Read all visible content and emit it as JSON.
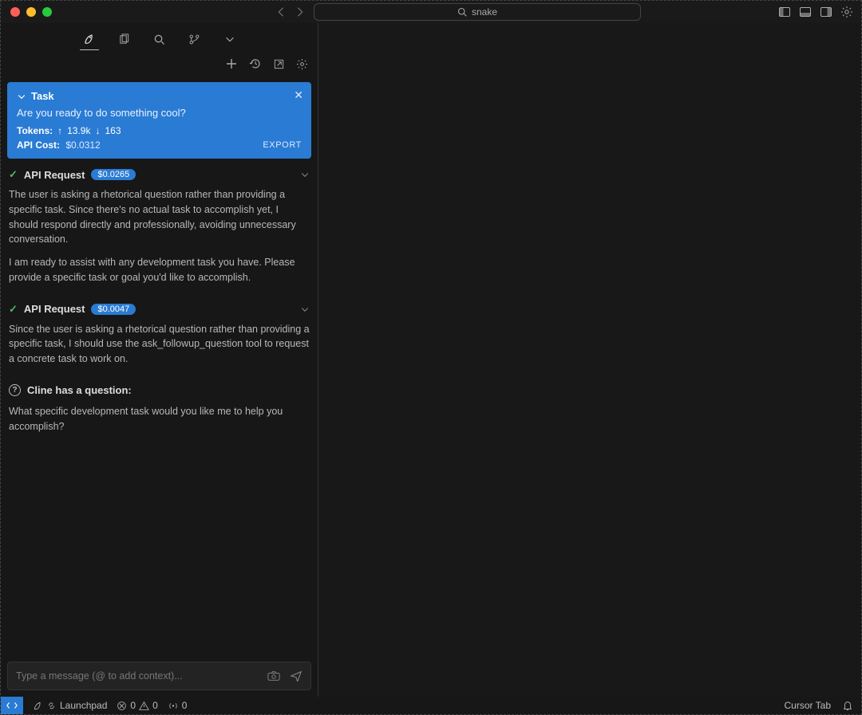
{
  "titlebar": {
    "search_text": "snake"
  },
  "task": {
    "label": "Task",
    "prompt": "Are you ready to do something cool?",
    "tokens_label": "Tokens:",
    "tokens_up": "13.9k",
    "tokens_down": "163",
    "cost_label": "API Cost:",
    "cost_value": "$0.0312",
    "export": "EXPORT"
  },
  "requests": [
    {
      "title": "API Request",
      "cost": "$0.0265",
      "paragraphs": [
        "The user is asking a rhetorical question rather than providing a specific task. Since there's no actual task to accomplish yet, I should respond directly and professionally, avoiding unnecessary conversation.",
        "I am ready to assist with any development task you have. Please provide a specific task or goal you'd like to accomplish."
      ]
    },
    {
      "title": "API Request",
      "cost": "$0.0047",
      "paragraphs": [
        "Since the user is asking a rhetorical question rather than providing a specific task, I should use the ask_followup_question tool to request a concrete task to work on."
      ]
    }
  ],
  "question": {
    "header": "Cline has a question:",
    "text": "What specific development task would you like me to help you accomplish?"
  },
  "input": {
    "placeholder": "Type a message (@ to add context)..."
  },
  "status": {
    "launchpad": "Launchpad",
    "errors": "0",
    "warnings": "0",
    "ports": "0",
    "cursor_tab": "Cursor Tab"
  }
}
